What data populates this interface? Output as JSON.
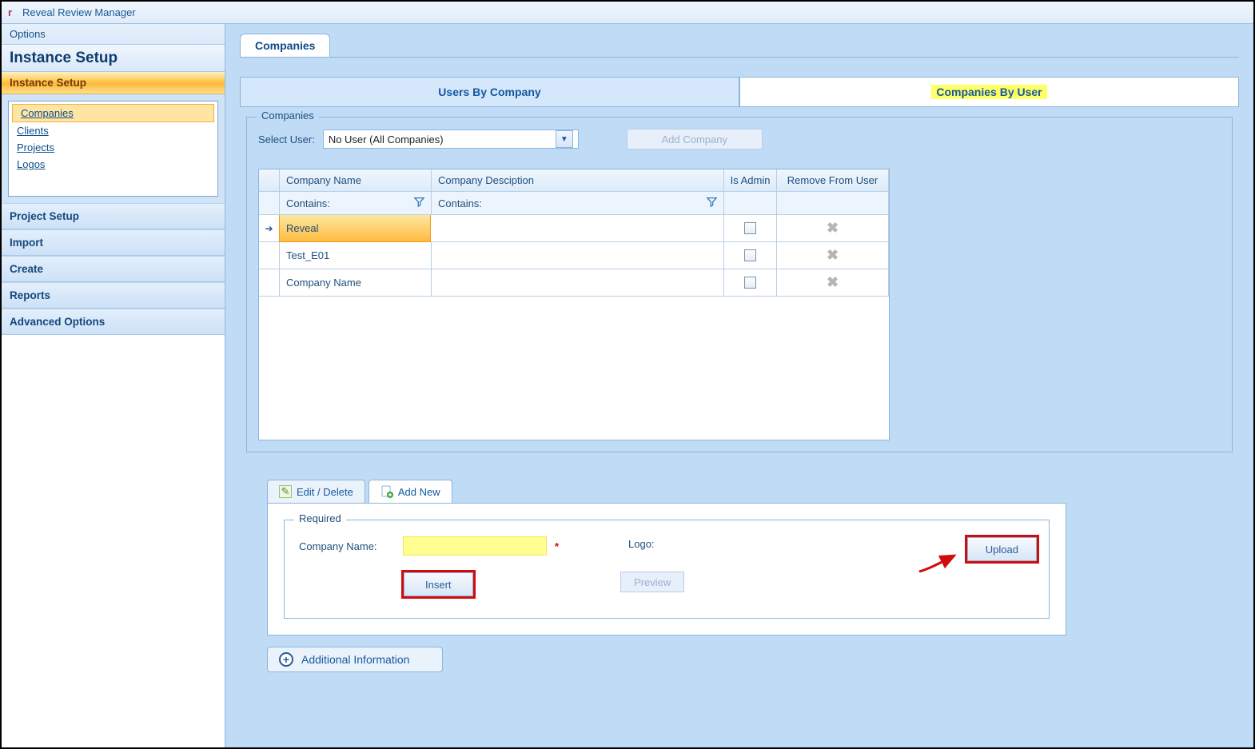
{
  "window": {
    "title": "Reveal Review Manager"
  },
  "sidebar": {
    "options_label": "Options",
    "section_title": "Instance Setup",
    "active_header": "Instance Setup",
    "items": [
      {
        "label": "Companies",
        "selected": true
      },
      {
        "label": "Clients",
        "selected": false
      },
      {
        "label": "Projects",
        "selected": false
      },
      {
        "label": "Logos",
        "selected": false
      }
    ],
    "collapsed": [
      {
        "label": "Project Setup"
      },
      {
        "label": "Import"
      },
      {
        "label": "Create"
      },
      {
        "label": "Reports"
      },
      {
        "label": "Advanced Options"
      }
    ]
  },
  "top_tab": {
    "label": "Companies"
  },
  "inner_tabs": {
    "left": {
      "label": "Users By Company"
    },
    "right": {
      "label": "Companies By User"
    }
  },
  "companies_panel": {
    "legend": "Companies",
    "select_user_label": "Select User:",
    "select_user_value": "No User (All Companies)",
    "add_company_label": "Add Company"
  },
  "grid": {
    "columns": {
      "name": "Company Name",
      "desc": "Company Desciption",
      "admin": "Is Admin",
      "remove": "Remove From User"
    },
    "filter_label": "Contains:",
    "rows": [
      {
        "name": "Reveal",
        "desc": "",
        "admin": false,
        "selected": true
      },
      {
        "name": "Test_E01",
        "desc": "",
        "admin": false,
        "selected": false
      },
      {
        "name": "Company Name",
        "desc": "",
        "admin": false,
        "selected": false
      }
    ]
  },
  "lower_tabs": {
    "edit": "Edit / Delete",
    "add": "Add New"
  },
  "form": {
    "legend": "Required",
    "company_name_label": "Company Name:",
    "company_name_value": "",
    "insert_label": "Insert",
    "logo_label": "Logo:",
    "preview_label": "Preview",
    "upload_label": "Upload"
  },
  "additional": {
    "label": "Additional Information"
  }
}
